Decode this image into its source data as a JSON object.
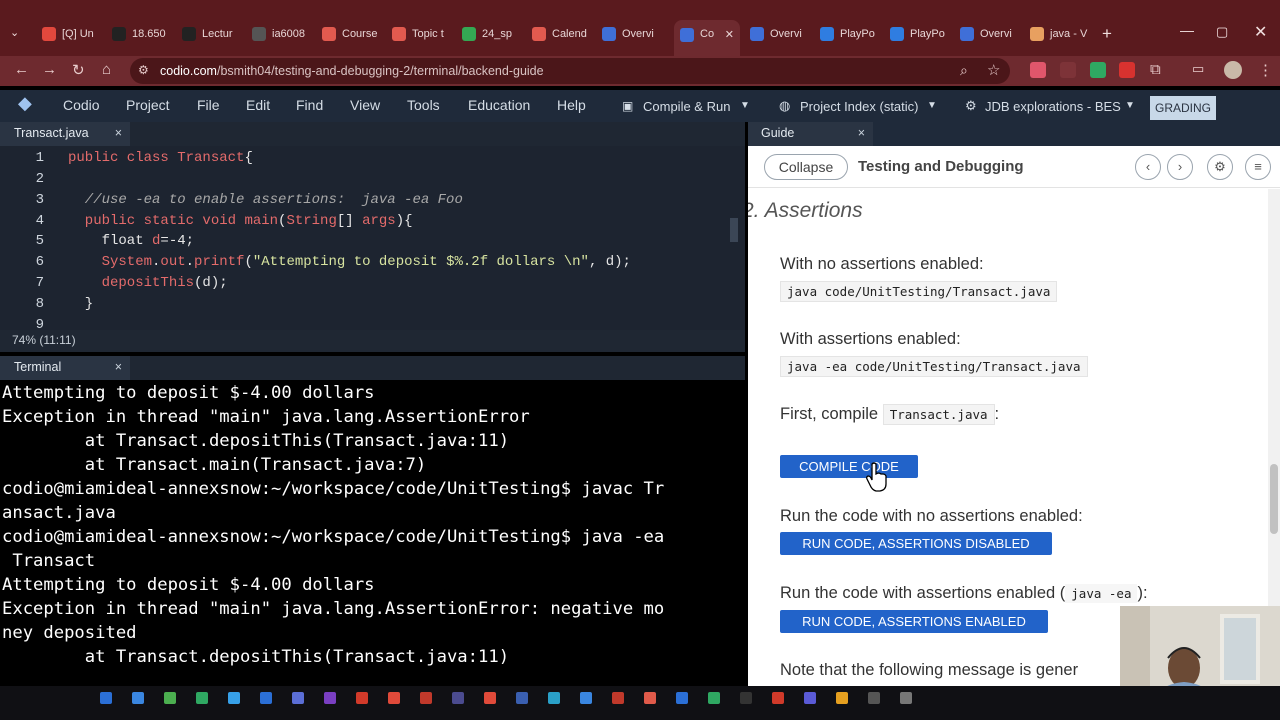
{
  "browser": {
    "tabs": [
      {
        "label": "[Q] Un",
        "color": "#e2483d",
        "icon": "reddit-icon"
      },
      {
        "label": "18.650",
        "color": "#222222",
        "icon": "pause-icon"
      },
      {
        "label": "Lectur",
        "color": "#222222",
        "icon": "pause-icon"
      },
      {
        "label": "ia6008",
        "color": "#555555",
        "icon": "globe-icon"
      },
      {
        "label": "Course",
        "color": "#e25a4f",
        "icon": "canvas-icon"
      },
      {
        "label": "Topic t",
        "color": "#e25a4f",
        "icon": "canvas-icon"
      },
      {
        "label": "24_sp",
        "color": "#34a853",
        "icon": "drive-icon"
      },
      {
        "label": "Calend",
        "color": "#e25a4f",
        "icon": "canvas-icon"
      },
      {
        "label": "Overvi",
        "color": "#3f6fd8",
        "icon": "codio-icon"
      },
      {
        "label": "Co",
        "color": "#3f6fd8",
        "icon": "codio-icon"
      },
      {
        "label": "Overvi",
        "color": "#3f6fd8",
        "icon": "codio-icon"
      },
      {
        "label": "PlayPo",
        "color": "#2f7de1",
        "icon": "playposit-icon"
      },
      {
        "label": "PlayPo",
        "color": "#2f7de1",
        "icon": "playposit-icon"
      },
      {
        "label": "Overvi",
        "color": "#3f6fd8",
        "icon": "codio-icon"
      },
      {
        "label": "java - V",
        "color": "#e8a060",
        "icon": "java-icon"
      }
    ],
    "url_host": "codio.com",
    "url_path": "/bsmith04/testing-and-debugging-2/terminal/backend-guide"
  },
  "menubar": {
    "items": [
      "Codio",
      "Project",
      "File",
      "Edit",
      "Find",
      "View",
      "Tools",
      "Education",
      "Help"
    ],
    "compile_run": "Compile & Run",
    "project_index": "Project Index (static)",
    "jdb": "JDB explorations - BES",
    "grading": "GRADING"
  },
  "editor": {
    "tab": "Transact.java",
    "close": "×",
    "line_numbers": [
      "1",
      "2",
      "3",
      "4",
      "5",
      "6",
      "7",
      "8",
      "9"
    ],
    "status": "74% (11:11)"
  },
  "terminal": {
    "tab": "Terminal",
    "close": "×",
    "lines": [
      "Attempting to deposit $-4.00 dollars",
      "Exception in thread \"main\" java.lang.AssertionError",
      "        at Transact.depositThis(Transact.java:11)",
      "        at Transact.main(Transact.java:7)",
      "codio@miamideal-annexsnow:~/workspace/code/UnitTesting$ javac Tr",
      "ansact.java",
      "codio@miamideal-annexsnow:~/workspace/code/UnitTesting$ java -ea",
      " Transact",
      "Attempting to deposit $-4.00 dollars",
      "Exception in thread \"main\" java.lang.AssertionError: negative mo",
      "ney deposited",
      "        at Transact.depositThis(Transact.java:11)"
    ]
  },
  "guide": {
    "tab": "Guide",
    "close": "×",
    "collapse": "Collapse",
    "title": "Testing and Debugging",
    "section": "2. Assertions",
    "no_assert_label": "With no assertions enabled:",
    "no_assert_cmd": "java code/UnitTesting/Transact.java",
    "assert_label": "With assertions enabled:",
    "assert_cmd": "java -ea code/UnitTesting/Transact.java",
    "compile_prefix": "First, compile",
    "compile_file": "Transact.java",
    "compile_suffix": ":",
    "compile_button": "COMPILE CODE",
    "run_no_label": "Run the code with no assertions enabled:",
    "run_no_button": "RUN CODE, ASSERTIONS DISABLED",
    "run_yes_prefix": "Run the code with assertions enabled (",
    "run_yes_code": "java -ea",
    "run_yes_suffix": "):",
    "run_yes_button": "RUN CODE, ASSERTIONS ENABLED",
    "note": "Note that the following message is gener"
  }
}
